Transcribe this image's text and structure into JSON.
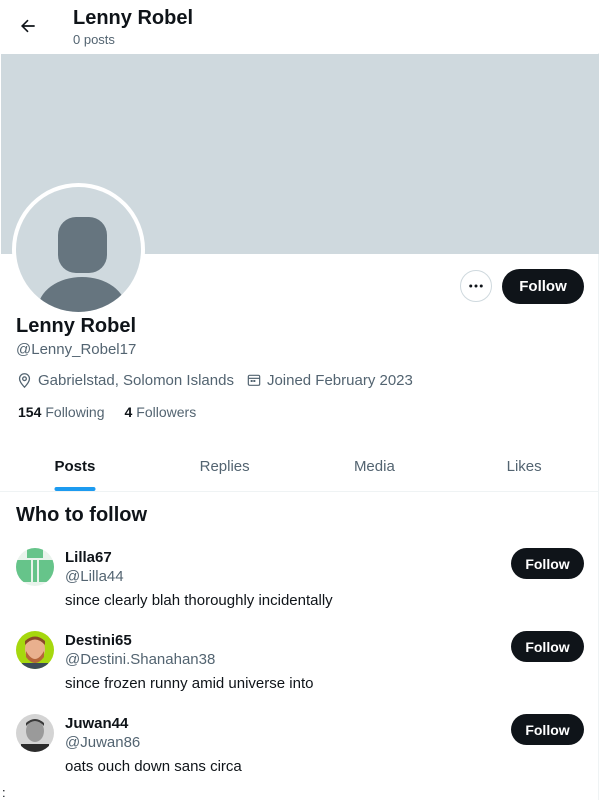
{
  "header": {
    "title": "Lenny Robel",
    "subtitle": "0 posts"
  },
  "profile": {
    "name": "Lenny Robel",
    "handle": "@Lenny_Robel17",
    "location": "Gabrielstad, Solomon Islands",
    "joined": "Joined February 2023",
    "following_count": "154",
    "following_label": "Following",
    "followers_count": "4",
    "followers_label": "Followers",
    "follow_label": "Follow"
  },
  "tabs": [
    {
      "label": "Posts",
      "active": true
    },
    {
      "label": "Replies"
    },
    {
      "label": "Media"
    },
    {
      "label": "Likes"
    }
  ],
  "who_to_follow": {
    "title": "Who to follow",
    "items": [
      {
        "name": "Lilla67",
        "handle": "@Lilla44",
        "bio": "since clearly blah thoroughly incidentally",
        "follow_label": "Follow"
      },
      {
        "name": "Destini65",
        "handle": "@Destini.Shanahan38",
        "bio": "since frozen runny amid universe into",
        "follow_label": "Follow"
      },
      {
        "name": "Juwan44",
        "handle": "@Juwan86",
        "bio": "oats ouch down sans circa",
        "follow_label": "Follow"
      }
    ]
  },
  "stray_char": ":",
  "colors": {
    "accent": "#1d9bf0",
    "banner": "#cfd9de",
    "text": "#0f1419",
    "muted": "#536471"
  },
  "icons": [
    "back-arrow-icon",
    "more-icon",
    "location-icon",
    "calendar-icon"
  ]
}
